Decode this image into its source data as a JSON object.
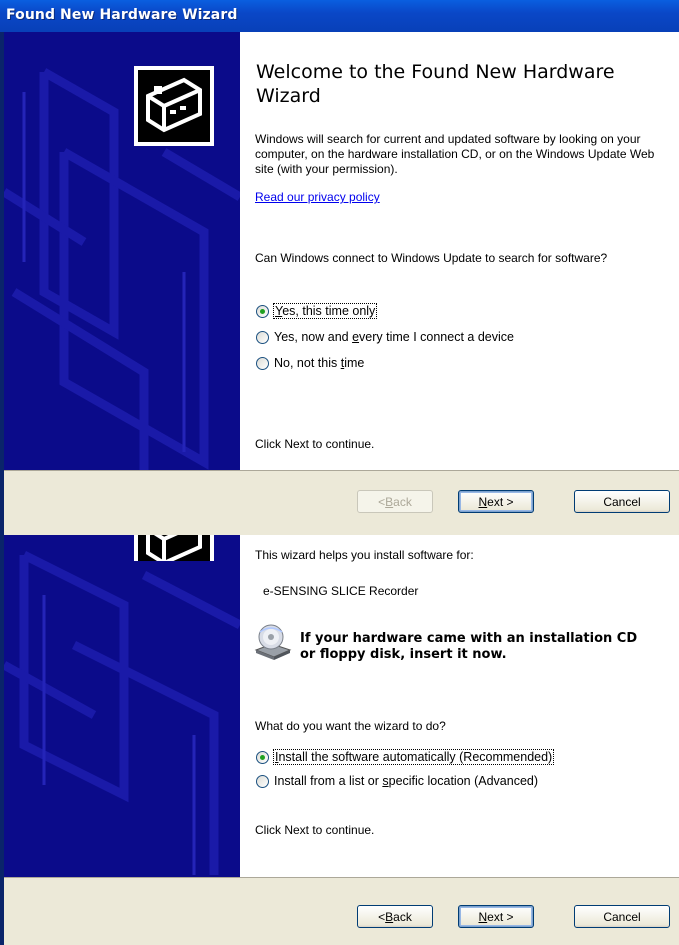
{
  "window": {
    "title": "Found New Hardware Wizard"
  },
  "page1": {
    "heading": "Welcome to the Found New Hardware Wizard",
    "description": "Windows will search for current and updated software by looking on your computer, on the hardware installation CD, or on the Windows Update Web site (with your permission).",
    "privacy_link": "Read our privacy policy",
    "question": "Can Windows connect to Windows Update to search for software?",
    "options": [
      {
        "pre": "",
        "u": "Y",
        "post": "es, this time only",
        "selected": true
      },
      {
        "pre": "Yes, now and ",
        "u": "e",
        "post": "very time I connect a device",
        "selected": false
      },
      {
        "pre": "No, not this ",
        "u": "t",
        "post": "ime",
        "selected": false
      }
    ],
    "footer": "Click Next to continue.",
    "buttons": {
      "back": {
        "pre": "< ",
        "u": "B",
        "post": "ack",
        "enabled": false
      },
      "next": {
        "pre": "",
        "u": "N",
        "post": "ext >"
      },
      "cancel": "Cancel"
    }
  },
  "page2": {
    "intro": "This wizard helps you install software for:",
    "device": "e-SENSING SLICE Recorder",
    "cd_prompt_line1": "If your hardware came with an installation CD",
    "cd_prompt_line2": "or floppy disk, insert it now.",
    "question": "What do you want the wizard to do?",
    "options": [
      {
        "pre": "",
        "u": "I",
        "post": "nstall the software automatically (Recommended)",
        "selected": true
      },
      {
        "pre": "Install from a list or ",
        "u": "s",
        "post": "pecific location (Advanced)",
        "selected": false
      }
    ],
    "footer": "Click Next to continue.",
    "buttons": {
      "back": {
        "pre": "< ",
        "u": "B",
        "post": "ack",
        "enabled": true
      },
      "next": {
        "pre": "",
        "u": "N",
        "post": "ext >"
      },
      "cancel": "Cancel"
    }
  },
  "icons": [
    "hardware-icon",
    "cd-drive-icon"
  ],
  "colors": {
    "sidebar": "#0b0b8a",
    "titlebar": "#0a47c7",
    "button_bar": "#ece9d8",
    "link": "#0000ee",
    "radio_dot": "#21a121"
  }
}
